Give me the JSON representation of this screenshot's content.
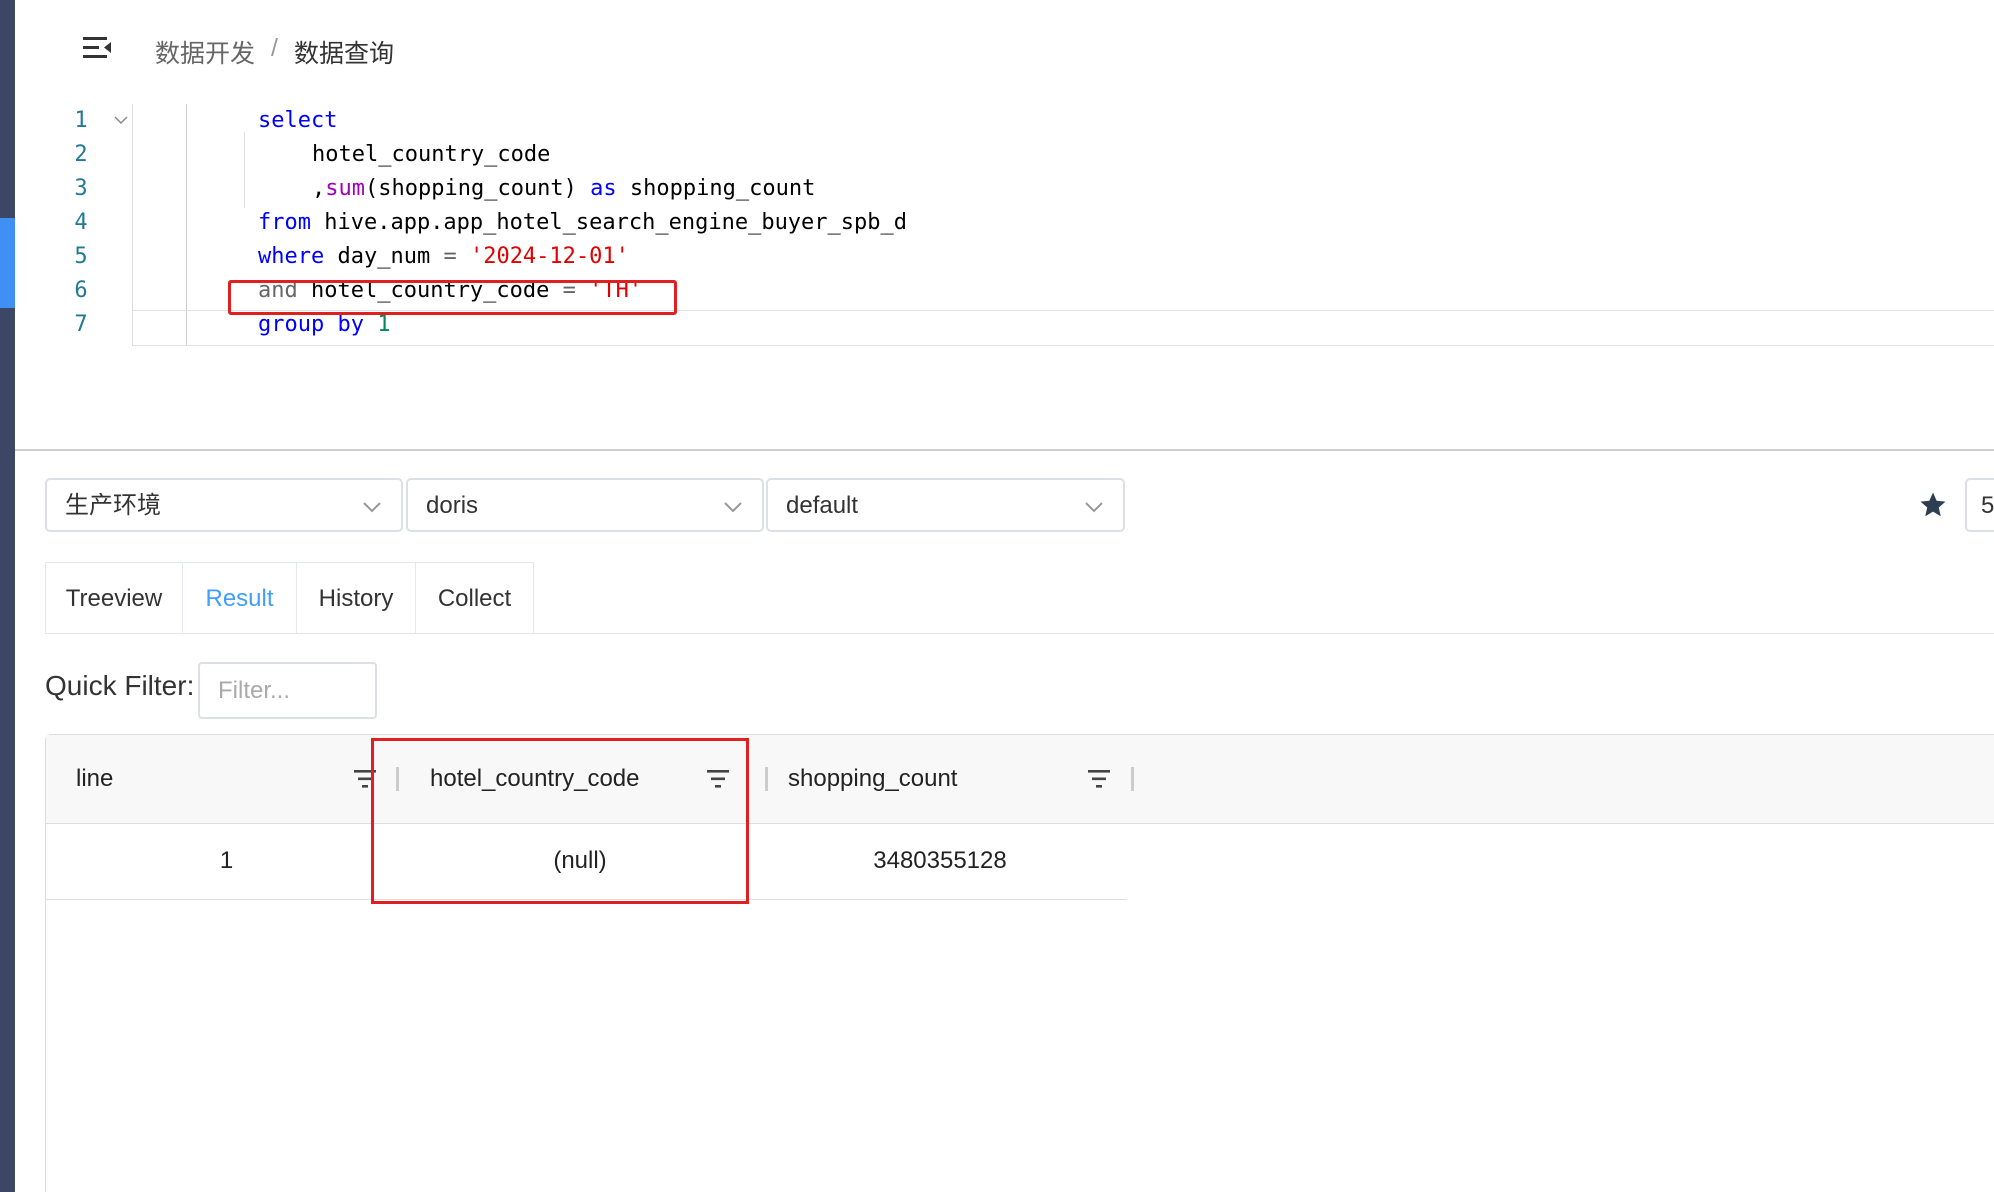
{
  "breadcrumb": {
    "parent": "数据开发",
    "separator": "/",
    "current": "数据查询"
  },
  "editor": {
    "lines": [
      {
        "n": "1",
        "tokens": [
          {
            "t": "select",
            "c": "kw"
          }
        ]
      },
      {
        "n": "2",
        "tokens": [
          {
            "t": "hotel_country_code",
            "c": ""
          }
        ]
      },
      {
        "n": "3",
        "tokens": [
          {
            "t": ",",
            "c": ""
          },
          {
            "t": "sum",
            "c": "fn"
          },
          {
            "t": "(shopping_count) ",
            "c": ""
          },
          {
            "t": "as",
            "c": "kw"
          },
          {
            "t": " shopping_count",
            "c": ""
          }
        ]
      },
      {
        "n": "4",
        "tokens": [
          {
            "t": "from",
            "c": "kw"
          },
          {
            "t": " hive.app.app_hotel_search_engine_buyer_spb_d",
            "c": ""
          }
        ]
      },
      {
        "n": "5",
        "tokens": [
          {
            "t": "where",
            "c": "kw"
          },
          {
            "t": " day_num ",
            "c": ""
          },
          {
            "t": "=",
            "c": "op"
          },
          {
            "t": " ",
            "c": ""
          },
          {
            "t": "'2024-12-01'",
            "c": "str"
          }
        ]
      },
      {
        "n": "6",
        "tokens": [
          {
            "t": "and",
            "c": "op"
          },
          {
            "t": " hotel_country_code ",
            "c": ""
          },
          {
            "t": "=",
            "c": "op"
          },
          {
            "t": " ",
            "c": ""
          },
          {
            "t": "'TH'",
            "c": "str"
          }
        ]
      },
      {
        "n": "7",
        "tokens": [
          {
            "t": "group by",
            "c": "kw"
          },
          {
            "t": " ",
            "c": ""
          },
          {
            "t": "1",
            "c": "num"
          }
        ]
      }
    ]
  },
  "selectors": {
    "environment": "生产环境",
    "engine": "doris",
    "database": "default",
    "partial_value": "5"
  },
  "tabs": [
    {
      "label": "Treeview"
    },
    {
      "label": "Result",
      "active": true
    },
    {
      "label": "History"
    },
    {
      "label": "Collect"
    }
  ],
  "quick_filter": {
    "label": "Quick Filter:",
    "placeholder": "Filter..."
  },
  "grid": {
    "columns": [
      "line",
      "hotel_country_code",
      "shopping_count"
    ],
    "rows": [
      [
        "1",
        "(null)",
        "3480355128"
      ]
    ]
  },
  "colors": {
    "accent": "#409eff",
    "highlight": "#e02020",
    "sidebar": "#3b4764",
    "sidebar_active": "#3f8ff5",
    "keyword": "#0000ff",
    "function": "#a000b8",
    "string": "#e00000",
    "number": "#098658"
  },
  "icons": {
    "menu": "menu-fold-icon",
    "star": "star-icon",
    "chevron": "chevron-down-icon",
    "filter": "filter-icon",
    "fold": "fold-chevron-icon"
  }
}
